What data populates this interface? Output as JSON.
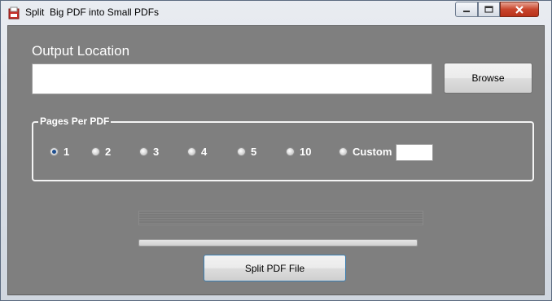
{
  "window": {
    "title": "Split  Big PDF into Small PDFs",
    "icon": "pdf-app-icon"
  },
  "output": {
    "label": "Output Location",
    "value": "",
    "browse_label": "Browse"
  },
  "pages_per_pdf": {
    "label": "Pages Per PDF",
    "options": [
      {
        "label": "1",
        "checked": true
      },
      {
        "label": "2",
        "checked": false
      },
      {
        "label": "3",
        "checked": false
      },
      {
        "label": "4",
        "checked": false
      },
      {
        "label": "5",
        "checked": false
      },
      {
        "label": "10",
        "checked": false
      },
      {
        "label": "Custom",
        "checked": false
      }
    ],
    "custom_value": ""
  },
  "progress": {
    "value": 0
  },
  "actions": {
    "split_label": "Split PDF File"
  },
  "colors": {
    "client_bg": "#7f7f7f",
    "close_button": "#c8452c",
    "radio_dot": "#1f4f8f"
  }
}
